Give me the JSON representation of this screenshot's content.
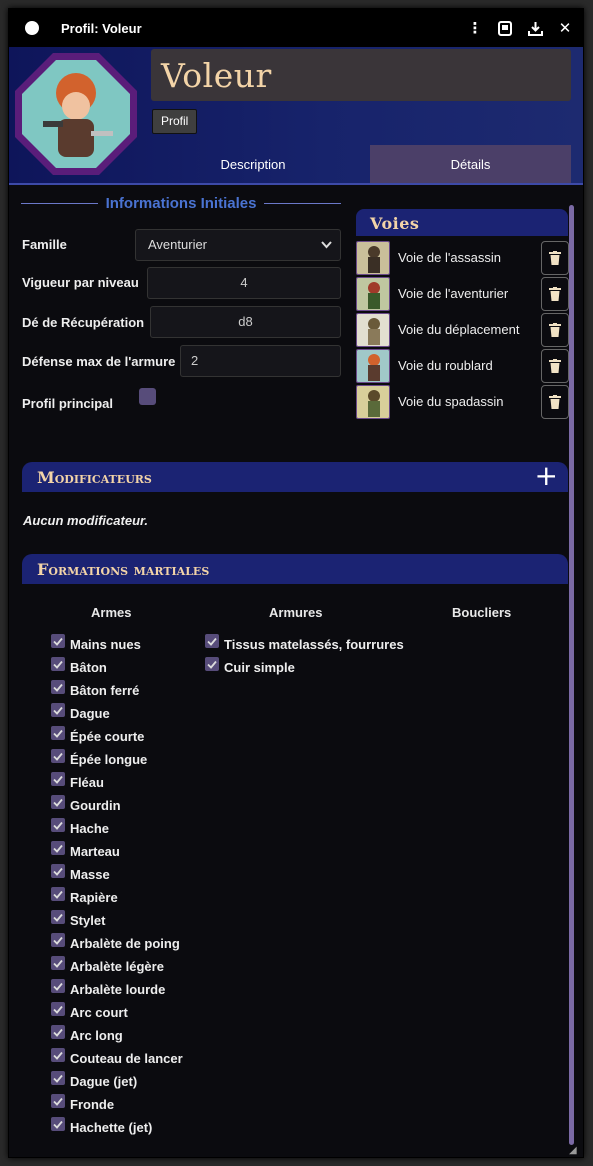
{
  "window": {
    "title": "Profil: Voleur"
  },
  "header": {
    "name": "Voleur",
    "tag": "Profil",
    "tabs": [
      {
        "label": "Description"
      },
      {
        "label": "Détails"
      }
    ]
  },
  "info": {
    "section_title": "Informations Initiales",
    "famille_label": "Famille",
    "famille_value": "Aventurier",
    "vigueur_label": "Vigueur par niveau",
    "vigueur_value": "4",
    "de_label": "Dé de Récupération",
    "de_value": "d8",
    "defense_label": "Défense max de l'armure",
    "defense_value": "2",
    "profil_principal_label": "Profil principal"
  },
  "voies": {
    "title": "Voies",
    "items": [
      {
        "label": "Voie de l'assassin"
      },
      {
        "label": "Voie de l'aventurier"
      },
      {
        "label": "Voie du déplacement"
      },
      {
        "label": "Voie du roublard"
      },
      {
        "label": "Voie du spadassin"
      }
    ]
  },
  "modificateurs": {
    "title": "Modificateurs",
    "empty_text": "Aucun modificateur."
  },
  "formations": {
    "title": "Formations martiales",
    "armes_label": "Armes",
    "armures_label": "Armures",
    "boucliers_label": "Boucliers",
    "armes": [
      "Mains nues",
      "Bâton",
      "Bâton ferré",
      "Dague",
      "Épée courte",
      "Épée longue",
      "Fléau",
      "Gourdin",
      "Hache",
      "Marteau",
      "Masse",
      "Rapière",
      "Stylet",
      "Arbalète de poing",
      "Arbalète légère",
      "Arbalète lourde",
      "Arc court",
      "Arc long",
      "Couteau de lancer",
      "Dague (jet)",
      "Fronde",
      "Hachette (jet)"
    ],
    "armures": [
      "Tissus matelassés, fourrures",
      "Cuir simple"
    ]
  },
  "colors": {
    "accent": "#4a73d2",
    "section_bar": "#1b2373",
    "title_gold": "#f3d4a8",
    "checkbox": "#574c7a"
  }
}
